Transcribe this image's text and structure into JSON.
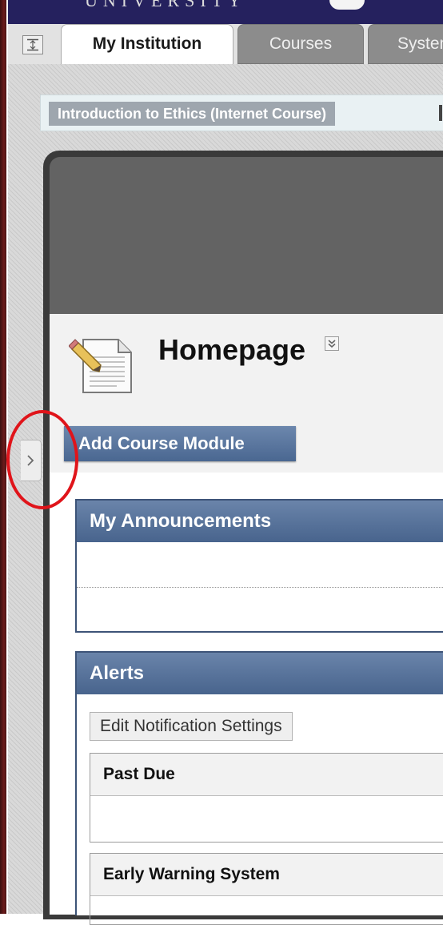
{
  "header": {
    "institution_name": "UNIVERSITY"
  },
  "tabs": [
    {
      "label": "My Institution",
      "active": true
    },
    {
      "label": "Courses",
      "active": false
    },
    {
      "label": "System",
      "active": false
    }
  ],
  "breadcrumb": {
    "course": "Introduction to Ethics (Internet Course)"
  },
  "page": {
    "title": "Homepage",
    "add_module_label": "Add Course Module"
  },
  "modules": {
    "announcements": {
      "title": "My Announcements"
    },
    "alerts": {
      "title": "Alerts",
      "edit_button": "Edit Notification Settings",
      "sections": [
        "Past Due",
        "Early Warning System"
      ]
    }
  },
  "colors": {
    "header": "#25215e",
    "module_header": "#48648d",
    "annotation": "#e0141a"
  },
  "icons": {
    "collapse": "expand-collapse-icon",
    "page": "document-page-icon",
    "title_menu": "double-chevron-down-icon",
    "menu_toggle": "chevron-right-icon"
  }
}
